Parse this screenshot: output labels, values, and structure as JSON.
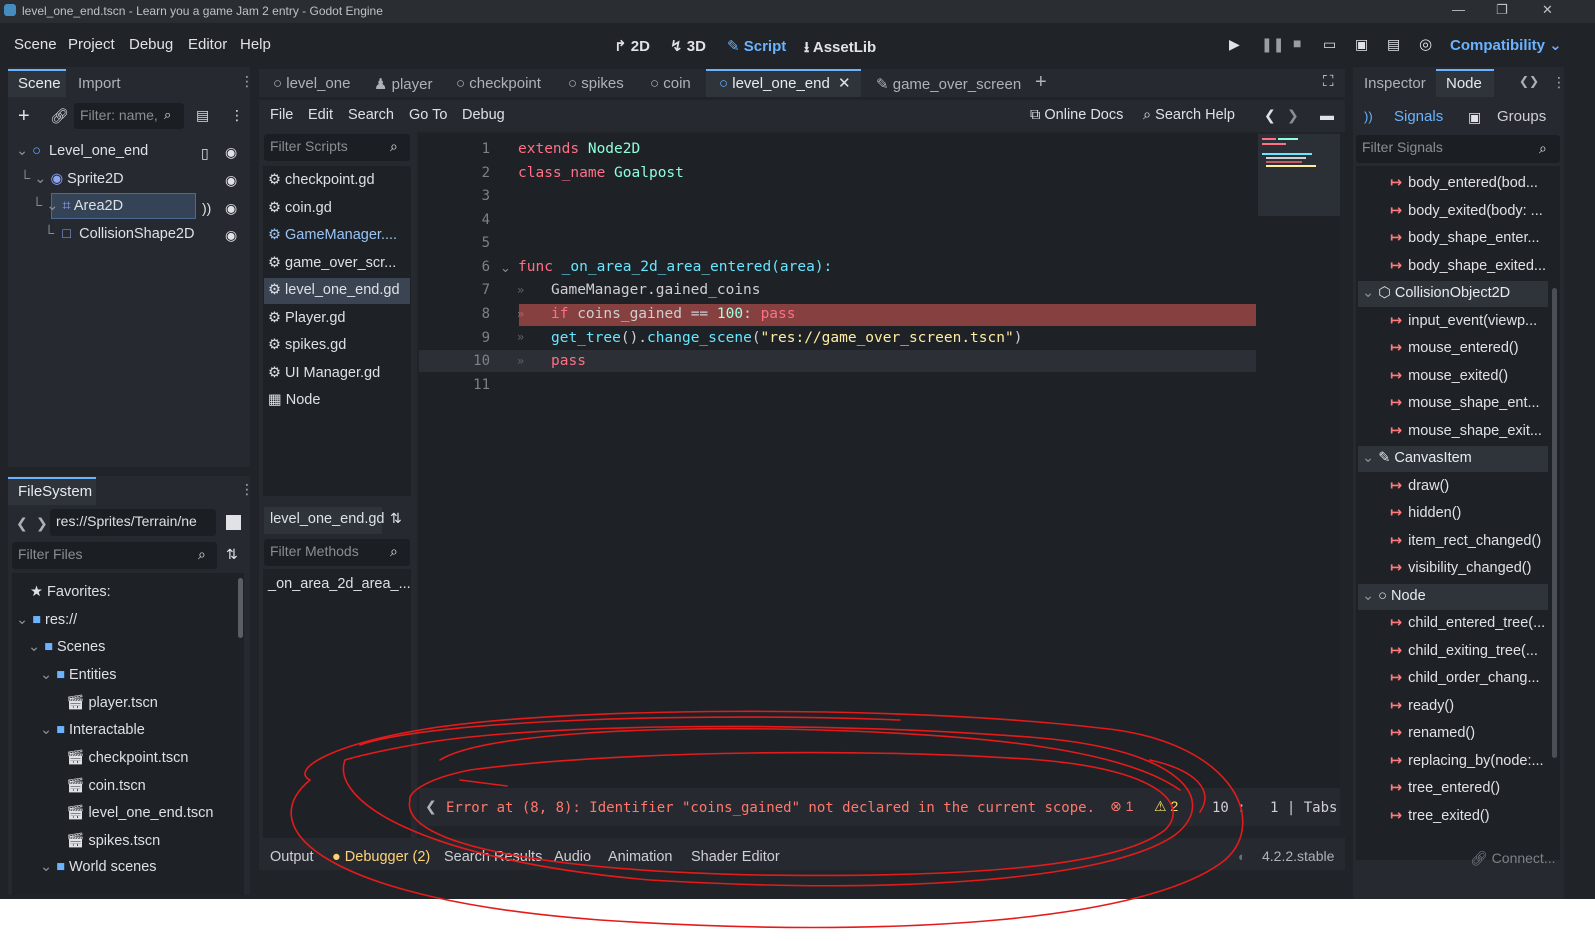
{
  "window": {
    "title": "level_one_end.tscn - Learn you a game Jam 2 entry - Godot Engine"
  },
  "menu": [
    "Scene",
    "Project",
    "Debug",
    "Editor",
    "Help"
  ],
  "modes": [
    "2D",
    "3D",
    "Script",
    "AssetLib"
  ],
  "renderer": "Compatibility",
  "scene_dock": {
    "tabs": [
      "Scene",
      "Import"
    ],
    "filter_placeholder": "Filter: name,",
    "tree": [
      "Level_one_end",
      "Sprite2D",
      "Area2D",
      "CollisionShape2D"
    ]
  },
  "filesystem": {
    "tab": "FileSystem",
    "path": "res://Sprites/Terrain/ne",
    "filter_placeholder": "Filter Files",
    "items": [
      "Favorites:",
      "res://",
      "Scenes",
      "Entities",
      "player.tscn",
      "Interactable",
      "checkpoint.tscn",
      "coin.tscn",
      "level_one_end.tscn",
      "spikes.tscn",
      "World scenes"
    ]
  },
  "editor_tabs": [
    "level_one",
    "player",
    "checkpoint",
    "spikes",
    "coin",
    "level_one_end",
    "game_over_screen"
  ],
  "script_menu": [
    "File",
    "Edit",
    "Search",
    "Go To",
    "Debug"
  ],
  "script_toolbar": {
    "online_docs": "Online Docs",
    "search_help": "Search Help"
  },
  "scripts": {
    "filter_placeholder": "Filter Scripts",
    "items": [
      "checkpoint.gd",
      "coin.gd",
      "GameManager....",
      "game_over_scr...",
      "level_one_end.gd",
      "Player.gd",
      "spikes.gd",
      "UI Manager.gd",
      "Node"
    ],
    "current": "level_one_end.gd",
    "methods_placeholder": "Filter Methods",
    "methods": [
      "_on_area_2d_area_..."
    ]
  },
  "code": {
    "line_numbers": [
      "1",
      "2",
      "3",
      "4",
      "5",
      "6",
      "7",
      "8",
      "9",
      "10",
      "11"
    ],
    "l1": [
      "extends",
      "Node2D"
    ],
    "l2": [
      "class_name",
      "Goalpost"
    ],
    "l6": [
      "func",
      "_on_area_2d_area_entered(area):"
    ],
    "l7": "GameManager.gained_coins",
    "l8": [
      "if",
      "coins_gained ==",
      "100",
      ":",
      "pass"
    ],
    "l9": [
      "get_tree",
      "().",
      "change_scene",
      "(",
      "\"res://game_over_screen.tscn\"",
      ")"
    ],
    "l10": "pass"
  },
  "status": {
    "error": "Error at (8, 8): Identifier \"coins_gained\" not declared in the current scope.",
    "errors": "1",
    "warnings": "2",
    "line": "10",
    "col": "1",
    "indent": "Tabs"
  },
  "bottom_tabs": [
    "Output",
    "Debugger (2)",
    "Search Results",
    "Audio",
    "Animation",
    "Shader Editor"
  ],
  "version": "4.2.2.stable",
  "inspector": {
    "tabs": [
      "Inspector",
      "Node"
    ],
    "subtabs": [
      "Signals",
      "Groups"
    ],
    "filter_placeholder": "Filter Signals",
    "signals_a": [
      "body_entered(bod...",
      "body_exited(body: ...",
      "body_shape_enter...",
      "body_shape_exited..."
    ],
    "class_b": "CollisionObject2D",
    "signals_b": [
      "input_event(viewp...",
      "mouse_entered()",
      "mouse_exited()",
      "mouse_shape_ent...",
      "mouse_shape_exit..."
    ],
    "class_c": "CanvasItem",
    "signals_c": [
      "draw()",
      "hidden()",
      "item_rect_changed()",
      "visibility_changed()"
    ],
    "class_d": "Node",
    "signals_d": [
      "child_entered_tree(...",
      "child_exiting_tree(...",
      "child_order_chang...",
      "ready()",
      "renamed()",
      "replacing_by(node:...",
      "tree_entered()",
      "tree_exited()"
    ],
    "connect": "Connect..."
  },
  "colors": {
    "accent": "#6ab3ff",
    "error": "#ff786b",
    "annotation": "#e31b1b"
  }
}
